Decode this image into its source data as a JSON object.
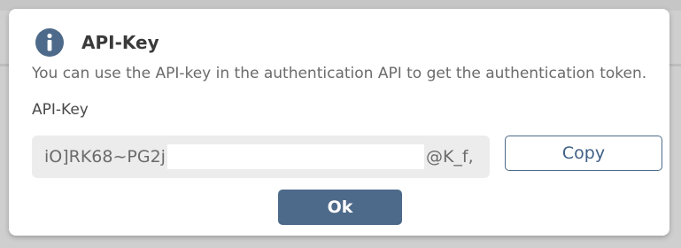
{
  "dialog": {
    "title": "API-Key",
    "title_icon": "info-icon",
    "description": "You can use the API-key in the authentication API to get the authentication token.",
    "field_label": "API-Key",
    "api_key_prefix": "iO]RK68~PG2j",
    "api_key_suffix": "@K_f,",
    "copy_label": "Copy",
    "ok_label": "Ok"
  },
  "colors": {
    "accent": "#4e6a8a",
    "input_background": "#ececec",
    "text_muted": "#6b6b6b"
  }
}
